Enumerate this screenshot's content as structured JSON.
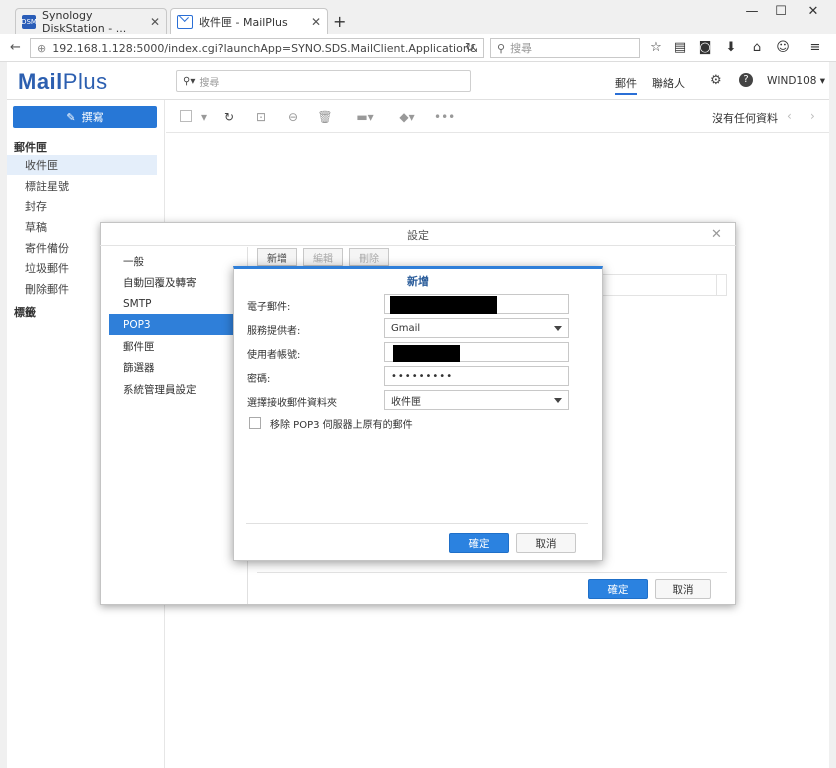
{
  "browser": {
    "tabs": [
      {
        "label": "Synology DiskStation - ...",
        "favicon": "DSM"
      },
      {
        "label": "收件匣 - MailPlus"
      }
    ],
    "url": "192.168.1.128:5000/index.cgi?launchApp=SYNO.SDS.MailClient.Application&Syr",
    "search_placeholder": "搜尋"
  },
  "app": {
    "logo_mail": "Mail",
    "logo_plus": "Plus",
    "search_placeholder": "搜尋",
    "header_links": [
      "郵件",
      "聯絡人"
    ],
    "user": "WIND108",
    "compose_label": "撰寫",
    "mailbox_heading": "郵件匣",
    "folders": [
      "收件匣",
      "標註星號",
      "封存",
      "草稿",
      "寄件備份",
      "垃圾郵件",
      "刪除郵件"
    ],
    "labels_heading": "標籤",
    "no_data": "沒有任何資料"
  },
  "settings": {
    "title": "設定",
    "nav": [
      "一般",
      "自動回覆及轉寄",
      "SMTP",
      "POP3",
      "郵件匣",
      "篩選器",
      "系統管理員設定"
    ],
    "active_nav": "POP3",
    "buttons": {
      "add": "新增",
      "edit": "編輯",
      "delete": "刪除"
    },
    "ok": "確定",
    "cancel": "取消"
  },
  "add_dialog": {
    "title": "新增",
    "fields": [
      {
        "label": "電子郵件:",
        "value": ""
      },
      {
        "label": "服務提供者:",
        "value": "Gmail"
      },
      {
        "label": "使用者帳號:",
        "value": ""
      },
      {
        "label": "密碼:",
        "value": "•••••••••"
      },
      {
        "label": "選擇接收郵件資料夾",
        "value": "收件匣"
      }
    ],
    "checkbox_label": "移除 POP3 伺服器上原有的郵件",
    "ok": "確定",
    "cancel": "取消"
  }
}
